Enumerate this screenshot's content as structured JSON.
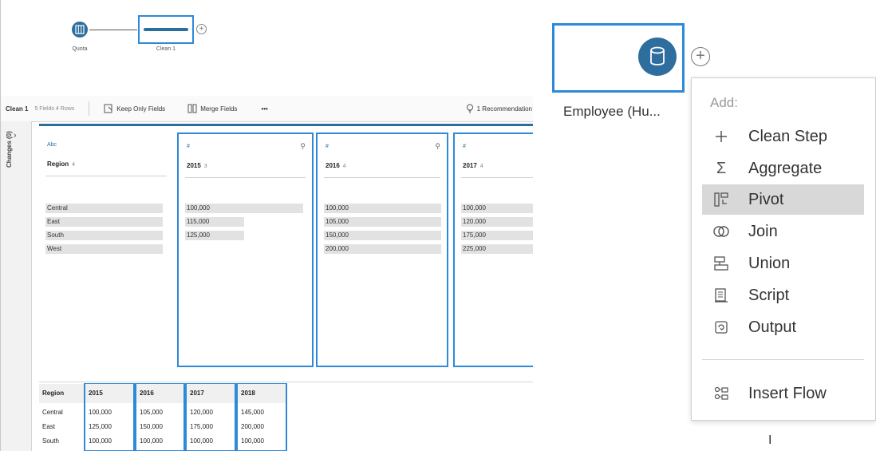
{
  "flow": {
    "nodes": [
      {
        "label": "Quota"
      },
      {
        "label": "Clean 1"
      }
    ]
  },
  "toolbar": {
    "step_name": "Clean 1",
    "step_meta": "5 Fields  4 Rows",
    "keep_only": "Keep Only Fields",
    "merge": "Merge Fields",
    "more": "•••",
    "recommendations": "1 Recommendation"
  },
  "changes_rail": {
    "chevron": "›",
    "label": "Changes (0)"
  },
  "profile": {
    "cards": [
      {
        "type": "Abc",
        "name": "Region",
        "count": "4",
        "values": [
          "Central",
          "East",
          "South",
          "West"
        ],
        "fills": [
          1,
          1,
          1,
          1
        ]
      },
      {
        "type": "#",
        "name": "2015",
        "count": "3",
        "values": [
          "100,000",
          "115,000",
          "125,000"
        ],
        "fills": [
          1,
          0.5,
          0.5
        ]
      },
      {
        "type": "#",
        "name": "2016",
        "count": "4",
        "values": [
          "100,000",
          "105,000",
          "150,000",
          "200,000"
        ],
        "fills": [
          1,
          1,
          1,
          1
        ]
      },
      {
        "type": "#",
        "name": "2017",
        "count": "4",
        "values": [
          "100,000",
          "120,000",
          "175,000",
          "225,000"
        ],
        "fills": [
          1,
          1,
          1,
          1
        ]
      }
    ]
  },
  "grid": {
    "columns": [
      "Region",
      "2015",
      "2016",
      "2017",
      "2018"
    ],
    "rows": [
      [
        "Central",
        "100,000",
        "105,000",
        "120,000",
        "145,000"
      ],
      [
        "East",
        "125,000",
        "150,000",
        "175,000",
        "200,000"
      ],
      [
        "South",
        "100,000",
        "100,000",
        "100,000",
        "100,000"
      ]
    ]
  },
  "right": {
    "node_label": "Employee (Hu...",
    "plus": "+",
    "menu_title": "Add:",
    "menu_items": [
      {
        "label": "Clean Step",
        "icon": "plus-icon"
      },
      {
        "label": "Aggregate",
        "icon": "sigma-icon"
      },
      {
        "label": "Pivot",
        "icon": "pivot-icon",
        "highlighted": true
      },
      {
        "label": "Join",
        "icon": "join-icon"
      },
      {
        "label": "Union",
        "icon": "union-icon"
      },
      {
        "label": "Script",
        "icon": "script-icon"
      },
      {
        "label": "Output",
        "icon": "output-icon"
      }
    ],
    "insert_flow": "Insert Flow",
    "cursor": "I"
  },
  "colors": {
    "accent": "#2e6e9e",
    "selection": "#2e8ad8",
    "highlight": "#d8d8d8"
  }
}
